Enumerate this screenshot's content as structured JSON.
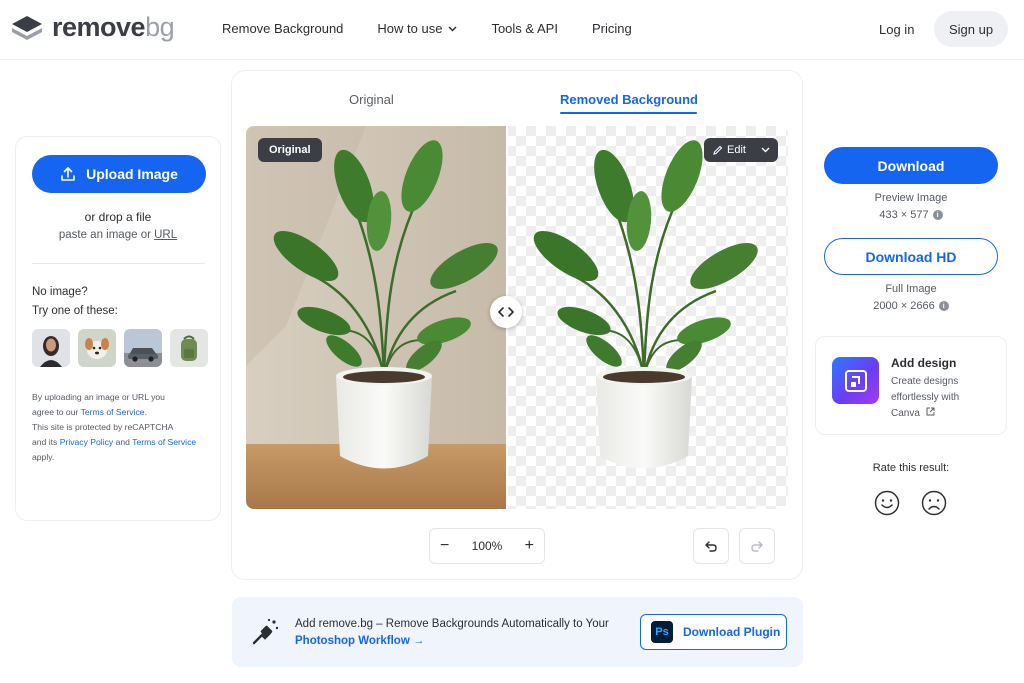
{
  "header": {
    "logo": {
      "word_main": "remove",
      "word_suffix": "bg"
    },
    "nav": [
      {
        "label": "Remove Background",
        "has_dropdown": false
      },
      {
        "label": "How to use",
        "has_dropdown": true
      },
      {
        "label": "Tools & API",
        "has_dropdown": false
      },
      {
        "label": "Pricing",
        "has_dropdown": false
      }
    ],
    "login_label": "Log in",
    "signup_label": "Sign up"
  },
  "left_panel": {
    "upload_label": "Upload Image",
    "drop_text": "or drop a file",
    "paste_prefix": "paste an image or ",
    "paste_url": "URL",
    "no_image_line1": "No image?",
    "no_image_line2": "Try one of these:",
    "legal": {
      "l1": "By uploading an image or URL you",
      "l2_prefix": "agree to our ",
      "terms": "Terms of Service",
      "l2_suffix": ".",
      "l3": "This site is protected by reCAPTCHA",
      "l4_prefix": "and its ",
      "privacy": "Privacy Policy",
      "l4_mid": " and ",
      "terms2": "Terms of Service",
      "l5": "apply."
    }
  },
  "editor": {
    "tabs": [
      {
        "label": "Original",
        "active": false
      },
      {
        "label": "Removed Background",
        "active": true
      }
    ],
    "original_badge": "Original",
    "edit_label": "Edit",
    "zoom_level": "100%",
    "zoom_out": "−",
    "zoom_in": "+"
  },
  "banner": {
    "line1": "Add remove.bg – Remove Backgrounds Automatically to Your",
    "line2": "Photoshop Workflow",
    "arrow": "→",
    "plugin_label": "Download Plugin",
    "ps_text": "Ps"
  },
  "right_panel": {
    "download_label": "Download",
    "preview_label": "Preview Image",
    "preview_size": "433 × 577",
    "download_hd_label": "Download HD",
    "full_label": "Full Image",
    "full_size": "2000 × 2666",
    "design": {
      "title": "Add design",
      "desc_l1": "Create designs",
      "desc_l2": "effortlessly with",
      "desc_l3": "Canva"
    },
    "rate_label": "Rate this result:"
  },
  "colors": {
    "accent": "#1565f0",
    "text": "#2b2d31",
    "muted": "#555a61",
    "dark_pill": "#3b3e44"
  }
}
